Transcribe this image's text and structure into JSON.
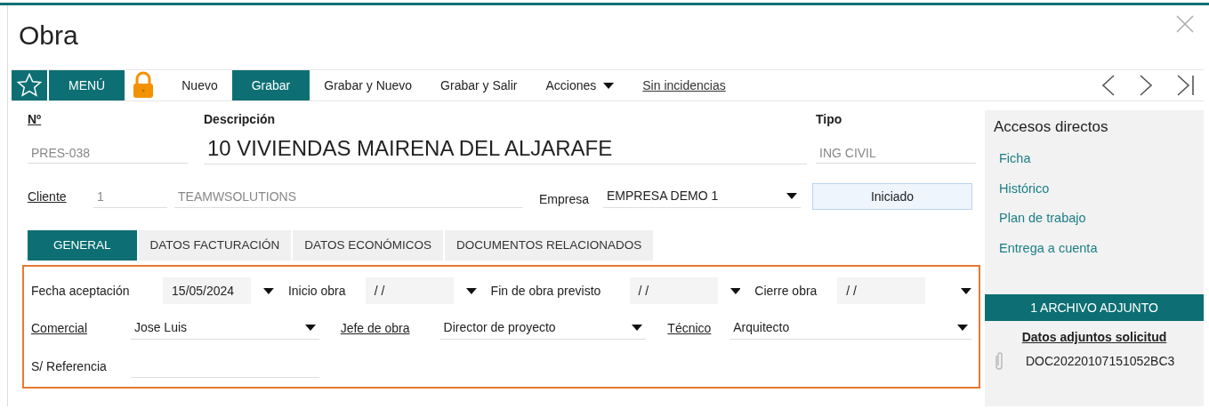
{
  "window": {
    "title": "Obra"
  },
  "toolbar": {
    "buttons": [
      {
        "label": "MENÚ",
        "kind": "primary"
      },
      {
        "label": "Nuevo",
        "kind": "plain"
      },
      {
        "label": "Grabar",
        "kind": "primary"
      },
      {
        "label": "Grabar y Nuevo",
        "kind": "plain"
      },
      {
        "label": "Grabar y Salir",
        "kind": "plain"
      },
      {
        "label": "Acciones",
        "kind": "dropdown"
      },
      {
        "label": "Sin incidencias",
        "kind": "link"
      }
    ]
  },
  "header": {
    "numero": {
      "label": "Nº",
      "link": true,
      "value": "PRES-038"
    },
    "descripcion": {
      "label": "Descripción",
      "link": false,
      "value": "10 VIVIENDAS MAIRENA DEL ALJARAFE"
    },
    "tipo": {
      "label": "Tipo",
      "link": false,
      "value": "ING CIVIL"
    },
    "cliente": {
      "label": "Cliente",
      "link": true,
      "code": "1",
      "name": "TEAMWSOLUTIONS"
    },
    "empresa": {
      "label": "Empresa",
      "link": false,
      "value": "EMPRESA DEMO 1"
    },
    "estado": "Iniciado"
  },
  "tabs": [
    {
      "label": "GENERAL",
      "selected": true
    },
    {
      "label": "DATOS FACTURACIÓN",
      "selected": false
    },
    {
      "label": "DATOS ECONÓMICOS",
      "selected": false
    },
    {
      "label": "DOCUMENTOS RELACIONADOS",
      "selected": false
    }
  ],
  "general": {
    "dates": [
      {
        "label": "Fecha aceptación",
        "value": "15/05/2024"
      },
      {
        "label": "Inicio obra",
        "value": "/ /"
      },
      {
        "label": "Fin de obra previsto",
        "value": "/ /"
      },
      {
        "label": "Cierre obra",
        "value": "/ /"
      }
    ],
    "people": [
      {
        "label": "Comercial",
        "link": true,
        "value": "Jose Luis"
      },
      {
        "label": "Jefe de obra",
        "link": true,
        "value": "Director de proyecto"
      },
      {
        "label": "Técnico",
        "link": true,
        "value": "Arquitecto"
      }
    ],
    "referencia": {
      "label": "S/ Referencia",
      "link": false
    }
  },
  "sidebar": {
    "title": "Accesos directos",
    "links": [
      "Ficha",
      "Histórico",
      "Plan de trabajo",
      "Entrega a cuenta"
    ],
    "attachments": {
      "header": "1 ARCHIVO ADJUNTO",
      "title": "Datos adjuntos solicitud",
      "files": [
        "DOC20220107151052BC3"
      ]
    }
  }
}
